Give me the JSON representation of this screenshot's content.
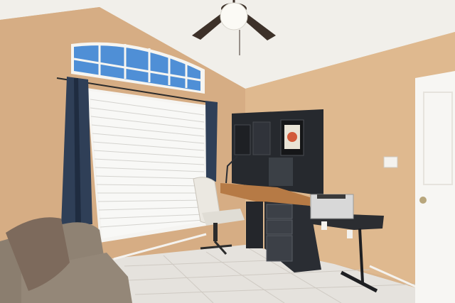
{
  "scene": {
    "kind": "photo",
    "colors": {
      "wall_left": "#d7ae86",
      "wall_right": "#dfb98f",
      "ceiling": "#f2f0ec",
      "floor": "#e4e1dc",
      "curtain": "#2f3f57",
      "blinds": "#f4f4f2",
      "desk_wood": "#b67a45",
      "desk_dark": "#2a2d33",
      "chair": "#e9e6df",
      "sofa": "#8f8273",
      "pillow": "#7d6a5c",
      "door": "#f7f6f3",
      "printer": "#d9d9d9"
    }
  }
}
